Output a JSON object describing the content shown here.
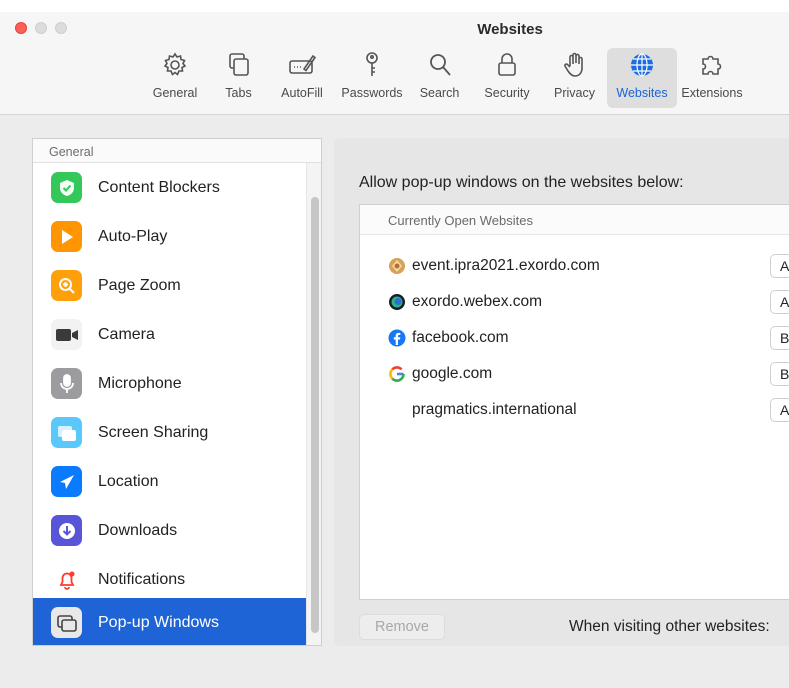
{
  "window": {
    "title": "Websites"
  },
  "toolbar": [
    {
      "label": "General",
      "icon": "gear-icon"
    },
    {
      "label": "Tabs",
      "icon": "tabs-icon"
    },
    {
      "label": "AutoFill",
      "icon": "autofill-icon"
    },
    {
      "label": "Passwords",
      "icon": "key-icon"
    },
    {
      "label": "Search",
      "icon": "search-icon"
    },
    {
      "label": "Security",
      "icon": "lock-icon"
    },
    {
      "label": "Privacy",
      "icon": "hand-icon"
    },
    {
      "label": "Websites",
      "icon": "globe-icon",
      "active": true
    },
    {
      "label": "Extensions",
      "icon": "puzzle-icon"
    }
  ],
  "sidebar": {
    "header": "General",
    "items": [
      {
        "label": "Content Blockers",
        "icon": "checkmark-shield-icon",
        "color": "#34c759"
      },
      {
        "label": "Auto-Play",
        "icon": "play-icon",
        "color": "#ff9500"
      },
      {
        "label": "Page Zoom",
        "icon": "zoom-icon",
        "color": "#ff9f0a"
      },
      {
        "label": "Camera",
        "icon": "camera-icon",
        "color": "#3a3a3c"
      },
      {
        "label": "Microphone",
        "icon": "microphone-icon",
        "color": "#8e8e93"
      },
      {
        "label": "Screen Sharing",
        "icon": "screen-sharing-icon",
        "color": "#5ac8fa"
      },
      {
        "label": "Location",
        "icon": "location-arrow-icon",
        "color": "#0a7aff"
      },
      {
        "label": "Downloads",
        "icon": "download-icon",
        "color": "#5856d6"
      },
      {
        "label": "Notifications",
        "icon": "bell-icon",
        "color": "#ff3b30"
      },
      {
        "label": "Pop-up Windows",
        "icon": "popup-windows-icon",
        "color": "#8e8e93",
        "selected": true
      }
    ]
  },
  "main": {
    "title": "Allow pop-up windows on the websites below:",
    "list_header": "Currently Open Websites",
    "sites": [
      {
        "domain": "event.ipra2021.exordo.com",
        "favicon": "exordo-favicon",
        "setting": "A"
      },
      {
        "domain": "exordo.webex.com",
        "favicon": "webex-favicon",
        "setting": "A"
      },
      {
        "domain": "facebook.com",
        "favicon": "facebook-favicon",
        "setting": "B"
      },
      {
        "domain": "google.com",
        "favicon": "google-favicon",
        "setting": "B"
      },
      {
        "domain": "pragmatics.international",
        "favicon": "",
        "setting": "A"
      }
    ],
    "remove_label": "Remove",
    "other_label": "When visiting other websites:"
  }
}
